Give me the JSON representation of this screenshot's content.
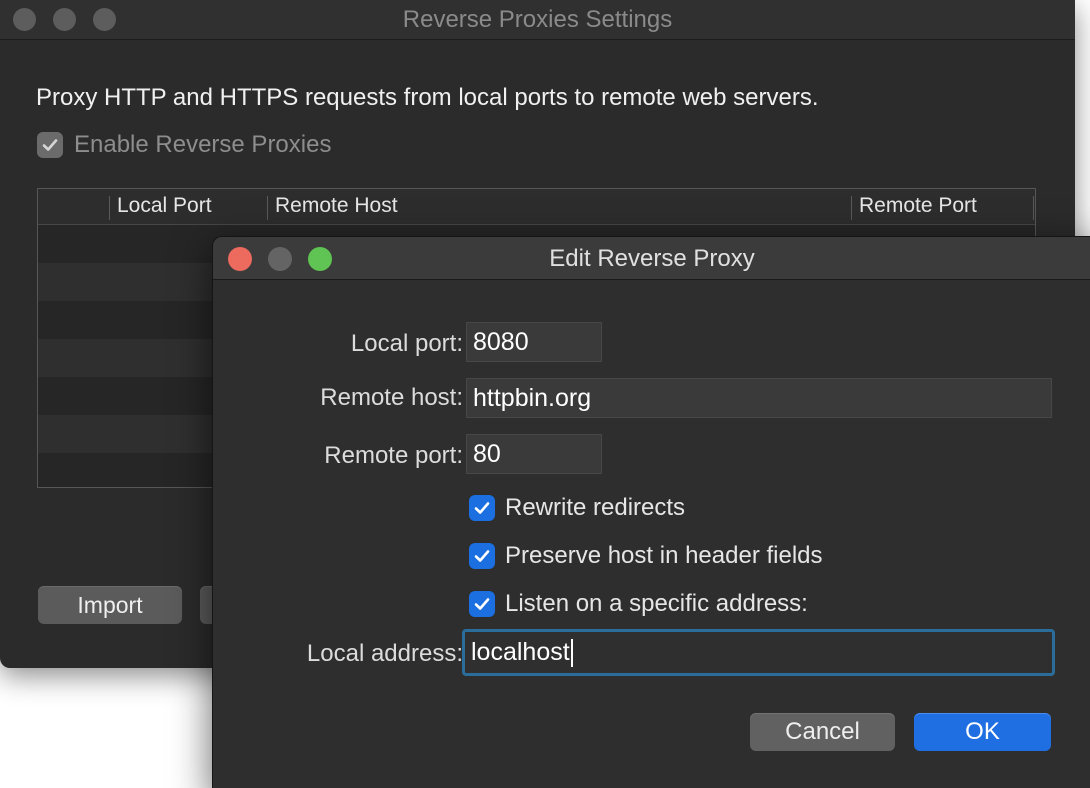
{
  "back_window": {
    "title": "Reverse Proxies Settings",
    "description": "Proxy HTTP and HTTPS requests from local ports to remote web servers.",
    "enable_label": "Enable Reverse Proxies",
    "enable_checked": true,
    "table": {
      "columns": [
        "Local Port",
        "Remote Host",
        "Remote Port"
      ],
      "rows": []
    },
    "buttons": {
      "import": "Import"
    }
  },
  "dialog": {
    "title": "Edit Reverse Proxy",
    "local_port_label": "Local port:",
    "local_port_value": "8080",
    "remote_host_label": "Remote host:",
    "remote_host_value": "httpbin.org",
    "remote_port_label": "Remote port:",
    "remote_port_value": "80",
    "options": [
      {
        "label": "Rewrite redirects",
        "checked": true
      },
      {
        "label": "Preserve host in header fields",
        "checked": true
      },
      {
        "label": "Listen on a specific address:",
        "checked": true
      }
    ],
    "local_address_label": "Local address:",
    "local_address_value": "localhost",
    "cancel_label": "Cancel",
    "ok_label": "OK"
  },
  "colors": {
    "accent_blue": "#1f6fe3",
    "close_red": "#ed6a5e",
    "zoom_green": "#5fc454",
    "focus_ring": "#2b6d9a"
  }
}
